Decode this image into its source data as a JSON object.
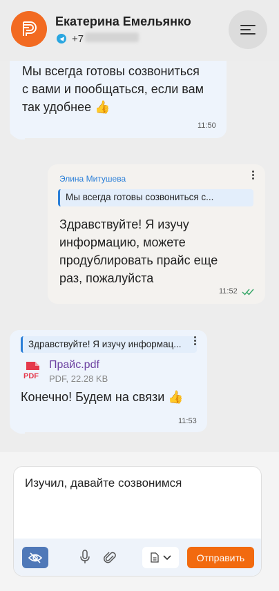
{
  "header": {
    "contact_name": "Екатерина Емельянко",
    "phone_prefix": "+7",
    "avatar_icon": "brand-logo-icon",
    "channel_icon": "telegram-icon",
    "menu_icon": "menu-icon"
  },
  "messages": [
    {
      "direction": "incoming",
      "lines": [
        "Мы всегда готовы созвониться",
        "с вами и пообщаться, если вам",
        "так удобнее 👍"
      ],
      "time": "11:50"
    },
    {
      "direction": "outgoing",
      "sender": "Элина Митушева",
      "reply_preview": "Мы всегда готовы созвониться с...",
      "lines": [
        "Здравствуйте! Я изучу",
        "информацию, можете",
        "продублировать прайс еще",
        "раз, пожалуйста"
      ],
      "time": "11:52",
      "status": "read"
    },
    {
      "direction": "incoming",
      "reply_preview": "Здравствуйте! Я изучу информац...",
      "attachment": {
        "name": "Прайс.pdf",
        "meta": "PDF, 22.28 KB",
        "badge": "PDF"
      },
      "lines": [
        "Конечно! Будем на связи 👍"
      ],
      "time": "11:53"
    }
  ],
  "composer": {
    "input_value": "Изучил, давайте созвонимся",
    "send_label": "Отправить"
  },
  "colors": {
    "accent": "#f26a0f",
    "link": "#2b7fd8",
    "pdf_red": "#e5394b",
    "attachment_purple": "#6b3fa0"
  }
}
